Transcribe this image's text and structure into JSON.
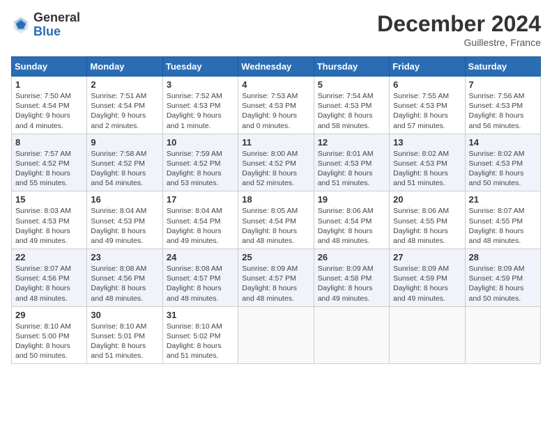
{
  "header": {
    "logo_general": "General",
    "logo_blue": "Blue",
    "month_title": "December 2024",
    "subtitle": "Guillestre, France"
  },
  "calendar": {
    "days_of_week": [
      "Sunday",
      "Monday",
      "Tuesday",
      "Wednesday",
      "Thursday",
      "Friday",
      "Saturday"
    ],
    "weeks": [
      [
        {
          "day": "1",
          "info": "Sunrise: 7:50 AM\nSunset: 4:54 PM\nDaylight: 9 hours\nand 4 minutes."
        },
        {
          "day": "2",
          "info": "Sunrise: 7:51 AM\nSunset: 4:54 PM\nDaylight: 9 hours\nand 2 minutes."
        },
        {
          "day": "3",
          "info": "Sunrise: 7:52 AM\nSunset: 4:53 PM\nDaylight: 9 hours\nand 1 minute."
        },
        {
          "day": "4",
          "info": "Sunrise: 7:53 AM\nSunset: 4:53 PM\nDaylight: 9 hours\nand 0 minutes."
        },
        {
          "day": "5",
          "info": "Sunrise: 7:54 AM\nSunset: 4:53 PM\nDaylight: 8 hours\nand 58 minutes."
        },
        {
          "day": "6",
          "info": "Sunrise: 7:55 AM\nSunset: 4:53 PM\nDaylight: 8 hours\nand 57 minutes."
        },
        {
          "day": "7",
          "info": "Sunrise: 7:56 AM\nSunset: 4:53 PM\nDaylight: 8 hours\nand 56 minutes."
        }
      ],
      [
        {
          "day": "8",
          "info": "Sunrise: 7:57 AM\nSunset: 4:52 PM\nDaylight: 8 hours\nand 55 minutes."
        },
        {
          "day": "9",
          "info": "Sunrise: 7:58 AM\nSunset: 4:52 PM\nDaylight: 8 hours\nand 54 minutes."
        },
        {
          "day": "10",
          "info": "Sunrise: 7:59 AM\nSunset: 4:52 PM\nDaylight: 8 hours\nand 53 minutes."
        },
        {
          "day": "11",
          "info": "Sunrise: 8:00 AM\nSunset: 4:52 PM\nDaylight: 8 hours\nand 52 minutes."
        },
        {
          "day": "12",
          "info": "Sunrise: 8:01 AM\nSunset: 4:53 PM\nDaylight: 8 hours\nand 51 minutes."
        },
        {
          "day": "13",
          "info": "Sunrise: 8:02 AM\nSunset: 4:53 PM\nDaylight: 8 hours\nand 51 minutes."
        },
        {
          "day": "14",
          "info": "Sunrise: 8:02 AM\nSunset: 4:53 PM\nDaylight: 8 hours\nand 50 minutes."
        }
      ],
      [
        {
          "day": "15",
          "info": "Sunrise: 8:03 AM\nSunset: 4:53 PM\nDaylight: 8 hours\nand 49 minutes."
        },
        {
          "day": "16",
          "info": "Sunrise: 8:04 AM\nSunset: 4:53 PM\nDaylight: 8 hours\nand 49 minutes."
        },
        {
          "day": "17",
          "info": "Sunrise: 8:04 AM\nSunset: 4:54 PM\nDaylight: 8 hours\nand 49 minutes."
        },
        {
          "day": "18",
          "info": "Sunrise: 8:05 AM\nSunset: 4:54 PM\nDaylight: 8 hours\nand 48 minutes."
        },
        {
          "day": "19",
          "info": "Sunrise: 8:06 AM\nSunset: 4:54 PM\nDaylight: 8 hours\nand 48 minutes."
        },
        {
          "day": "20",
          "info": "Sunrise: 8:06 AM\nSunset: 4:55 PM\nDaylight: 8 hours\nand 48 minutes."
        },
        {
          "day": "21",
          "info": "Sunrise: 8:07 AM\nSunset: 4:55 PM\nDaylight: 8 hours\nand 48 minutes."
        }
      ],
      [
        {
          "day": "22",
          "info": "Sunrise: 8:07 AM\nSunset: 4:56 PM\nDaylight: 8 hours\nand 48 minutes."
        },
        {
          "day": "23",
          "info": "Sunrise: 8:08 AM\nSunset: 4:56 PM\nDaylight: 8 hours\nand 48 minutes."
        },
        {
          "day": "24",
          "info": "Sunrise: 8:08 AM\nSunset: 4:57 PM\nDaylight: 8 hours\nand 48 minutes."
        },
        {
          "day": "25",
          "info": "Sunrise: 8:09 AM\nSunset: 4:57 PM\nDaylight: 8 hours\nand 48 minutes."
        },
        {
          "day": "26",
          "info": "Sunrise: 8:09 AM\nSunset: 4:58 PM\nDaylight: 8 hours\nand 49 minutes."
        },
        {
          "day": "27",
          "info": "Sunrise: 8:09 AM\nSunset: 4:59 PM\nDaylight: 8 hours\nand 49 minutes."
        },
        {
          "day": "28",
          "info": "Sunrise: 8:09 AM\nSunset: 4:59 PM\nDaylight: 8 hours\nand 50 minutes."
        }
      ],
      [
        {
          "day": "29",
          "info": "Sunrise: 8:10 AM\nSunset: 5:00 PM\nDaylight: 8 hours\nand 50 minutes."
        },
        {
          "day": "30",
          "info": "Sunrise: 8:10 AM\nSunset: 5:01 PM\nDaylight: 8 hours\nand 51 minutes."
        },
        {
          "day": "31",
          "info": "Sunrise: 8:10 AM\nSunset: 5:02 PM\nDaylight: 8 hours\nand 51 minutes."
        },
        {
          "day": "",
          "info": ""
        },
        {
          "day": "",
          "info": ""
        },
        {
          "day": "",
          "info": ""
        },
        {
          "day": "",
          "info": ""
        }
      ]
    ]
  }
}
